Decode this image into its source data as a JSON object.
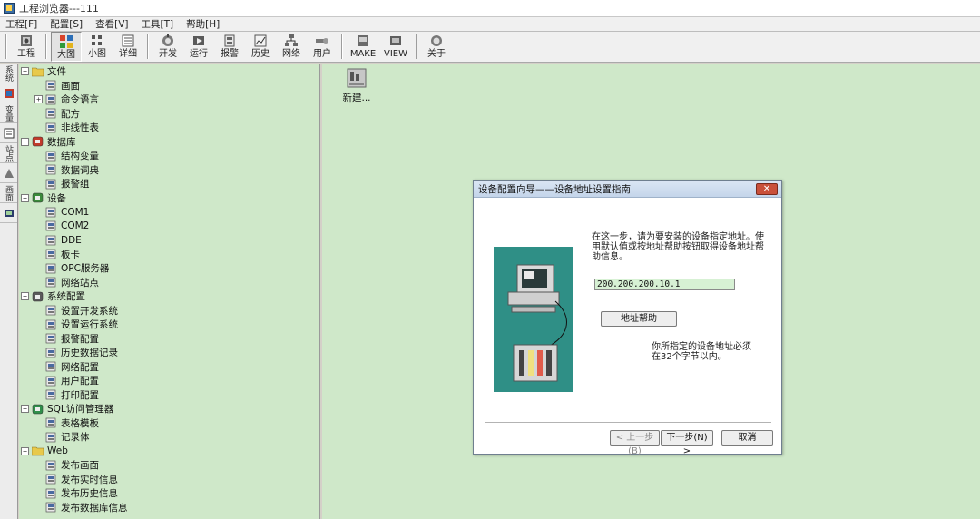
{
  "window": {
    "title": "工程浏览器---111"
  },
  "menu": [
    "工程[F]",
    "配置[S]",
    "查看[V]",
    "工具[T]",
    "帮助[H]"
  ],
  "toolbar": {
    "groups": [
      [
        {
          "label": "工程",
          "icon": "project-icon"
        }
      ],
      [
        {
          "label": "大图",
          "icon": "large-icon-view-icon",
          "active": true
        },
        {
          "label": "小图",
          "icon": "small-icon-view-icon"
        },
        {
          "label": "详细",
          "icon": "detail-view-icon"
        }
      ],
      [
        {
          "label": "开发",
          "icon": "develop-icon"
        },
        {
          "label": "运行",
          "icon": "run-icon"
        },
        {
          "label": "报警",
          "icon": "alarm-icon"
        },
        {
          "label": "历史",
          "icon": "history-icon"
        },
        {
          "label": "网络",
          "icon": "network-icon"
        },
        {
          "label": "用户",
          "icon": "user-icon"
        }
      ],
      [
        {
          "label": "MAKE",
          "icon": "make-icon"
        },
        {
          "label": "VIEW",
          "icon": "view-icon"
        }
      ],
      [
        {
          "label": "关于",
          "icon": "about-icon"
        }
      ]
    ]
  },
  "left_tabs": [
    "系统",
    "变量",
    "站点",
    "画面"
  ],
  "tree": [
    {
      "label": "文件",
      "level": 0,
      "icon": "folder-icon",
      "expander": "−"
    },
    {
      "label": "画面",
      "level": 1,
      "icon": "screen-icon"
    },
    {
      "label": "命令语言",
      "level": 1,
      "icon": "script-icon",
      "expander": "+"
    },
    {
      "label": "配方",
      "level": 1,
      "icon": "recipe-icon"
    },
    {
      "label": "非线性表",
      "level": 1,
      "icon": "table-icon"
    },
    {
      "label": "数据库",
      "level": 0,
      "icon": "database-icon",
      "expander": "−"
    },
    {
      "label": "结构变量",
      "level": 1,
      "icon": "struct-variable-icon"
    },
    {
      "label": "数据词典",
      "level": 1,
      "icon": "dictionary-icon"
    },
    {
      "label": "报警组",
      "level": 1,
      "icon": "alarm-group-icon"
    },
    {
      "label": "设备",
      "level": 0,
      "icon": "device-icon",
      "expander": "−"
    },
    {
      "label": "COM1",
      "level": 1,
      "icon": "com-port-icon"
    },
    {
      "label": "COM2",
      "level": 1,
      "icon": "com-port-icon"
    },
    {
      "label": "DDE",
      "level": 1,
      "icon": "dde-icon"
    },
    {
      "label": "板卡",
      "level": 1,
      "icon": "board-card-icon"
    },
    {
      "label": "OPC服务器",
      "level": 1,
      "icon": "opc-server-icon"
    },
    {
      "label": "网络站点",
      "level": 1,
      "icon": "network-station-icon"
    },
    {
      "label": "系统配置",
      "level": 0,
      "icon": "system-config-icon",
      "expander": "−"
    },
    {
      "label": "设置开发系统",
      "level": 1,
      "icon": "dev-settings-icon"
    },
    {
      "label": "设置运行系统",
      "level": 1,
      "icon": "run-settings-icon"
    },
    {
      "label": "报警配置",
      "level": 1,
      "icon": "alarm-config-icon"
    },
    {
      "label": "历史数据记录",
      "level": 1,
      "icon": "history-log-icon"
    },
    {
      "label": "网络配置",
      "level": 1,
      "icon": "network-config-icon"
    },
    {
      "label": "用户配置",
      "level": 1,
      "icon": "user-config-icon"
    },
    {
      "label": "打印配置",
      "level": 1,
      "icon": "print-config-icon"
    },
    {
      "label": "SQL访问管理器",
      "level": 0,
      "icon": "sql-manager-icon",
      "expander": "−"
    },
    {
      "label": "表格模板",
      "level": 1,
      "icon": "table-template-icon"
    },
    {
      "label": "记录体",
      "level": 1,
      "icon": "record-icon"
    },
    {
      "label": "Web",
      "level": 0,
      "icon": "folder-icon",
      "expander": "−"
    },
    {
      "label": "发布画面",
      "level": 1,
      "icon": "publish-screen-icon"
    },
    {
      "label": "发布实时信息",
      "level": 1,
      "icon": "publish-realtime-icon"
    },
    {
      "label": "发布历史信息",
      "level": 1,
      "icon": "publish-history-icon"
    },
    {
      "label": "发布数据库信息",
      "level": 1,
      "icon": "publish-database-icon"
    }
  ],
  "main": {
    "new_item_label": "新建..."
  },
  "dialog": {
    "title": "设备配置向导——设备地址设置指南",
    "instruction": "在这一步，请为要安装的设备指定地址。使用默认值或按地址帮助按钮取得设备地址帮助信息。",
    "address_value": "200.200.200.10.1",
    "help_button": "地址帮助",
    "note": "你所指定的设备地址必须在32个字节以内。",
    "prev_button": "< 上一步(B)",
    "next_button": "下一步(N) >",
    "cancel_button": "取消"
  }
}
